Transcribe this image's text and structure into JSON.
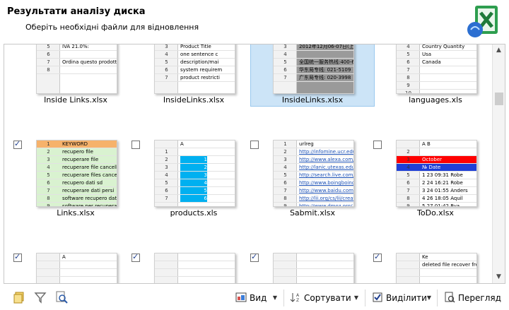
{
  "header": {
    "title": "Результати аналізу диска",
    "subtitle": "Оберіть необхідні файли для відновлення"
  },
  "files": [
    {
      "name": "Inside Links.xlsx",
      "selected": false,
      "checked": false,
      "rows": [
        {
          "n": "3",
          "t": ""
        },
        {
          "n": "4",
          "t": ""
        },
        {
          "n": "5",
          "t": "IVA 21.0%:"
        },
        {
          "n": "6",
          "t": ""
        },
        {
          "n": "7",
          "t": "Ordina questo prodotto"
        },
        {
          "n": "8",
          "t": ""
        }
      ]
    },
    {
      "name": "InsideLinks.xlsx",
      "selected": false,
      "checked": false,
      "rows": [
        {
          "n": "1",
          "t": ""
        },
        {
          "n": "2",
          "t": ""
        },
        {
          "n": "3",
          "t": "Product Title"
        },
        {
          "n": "4",
          "t": "one sentence c"
        },
        {
          "n": "5",
          "t": "description/mai"
        },
        {
          "n": "6",
          "t": "system requirem"
        },
        {
          "n": "7",
          "t": "product restricti"
        }
      ]
    },
    {
      "name": "InsideLinks.xlsx",
      "selected": true,
      "checked": false,
      "rows": [
        {
          "n": "1",
          "t": ""
        },
        {
          "n": "2",
          "t": "2012年11月03-04日(深圳"
        },
        {
          "n": "3",
          "t": "2012年12月06-07日(上海"
        },
        {
          "n": "4",
          "t": ""
        },
        {
          "n": "5",
          "t": "全国统一服务热线:400-6"
        },
        {
          "n": "6",
          "t": "华东局专线: 021-5109"
        },
        {
          "n": "7",
          "t": "广东局专线: 020-3998"
        }
      ]
    },
    {
      "name": "languages.xls",
      "selected": false,
      "checked": false,
      "rows": [
        {
          "n": "2",
          "t": "(A2)"
        },
        {
          "n": "3",
          "t": ""
        },
        {
          "n": "4",
          "t": "Country    Quantity"
        },
        {
          "n": "5",
          "t": "Usa"
        },
        {
          "n": "6",
          "t": "Canada"
        },
        {
          "n": "7",
          "t": ""
        },
        {
          "n": "8",
          "t": ""
        },
        {
          "n": "9",
          "t": ""
        },
        {
          "n": "10",
          "t": ""
        }
      ]
    },
    {
      "name": "Links.xlsx",
      "selected": false,
      "checked": true,
      "rows": [
        {
          "n": "1",
          "t": "KEYWORD"
        },
        {
          "n": "2",
          "t": "recupero file"
        },
        {
          "n": "3",
          "t": "recuperare file"
        },
        {
          "n": "4",
          "t": "recuperare file cancellati"
        },
        {
          "n": "5",
          "t": "recuperare files cancellati d"
        },
        {
          "n": "6",
          "t": "recupero dati sd"
        },
        {
          "n": "7",
          "t": "recuperare dati persi"
        },
        {
          "n": "8",
          "t": "software recupero dati free"
        },
        {
          "n": "9",
          "t": "software per recuperare file"
        }
      ]
    },
    {
      "name": "products.xls",
      "selected": false,
      "checked": false,
      "rows": [
        {
          "n": "",
          "t": "A"
        },
        {
          "n": "1",
          "t": ""
        },
        {
          "n": "2",
          "t": "1"
        },
        {
          "n": "3",
          "t": "2"
        },
        {
          "n": "4",
          "t": "3"
        },
        {
          "n": "5",
          "t": "4"
        },
        {
          "n": "6",
          "t": "5"
        },
        {
          "n": "7",
          "t": "6"
        }
      ]
    },
    {
      "name": "Sabmit.xlsx",
      "selected": false,
      "checked": false,
      "rows": [
        {
          "n": "1",
          "t": "urlreg"
        },
        {
          "n": "2",
          "t": "http://infomine.ucr.edu/"
        },
        {
          "n": "3",
          "t": "http://www.alexa.com/si"
        },
        {
          "n": "4",
          "t": "http://lanic.utexas.edu/l"
        },
        {
          "n": "5",
          "t": "http://search.live.com/d"
        },
        {
          "n": "6",
          "t": "http://www.boingboing.n"
        },
        {
          "n": "7",
          "t": "http://www.baidu.com/s"
        },
        {
          "n": "8",
          "t": "http://lii.org/cs/lii/create"
        },
        {
          "n": "9",
          "t": "http://www.dmoz.org/"
        },
        {
          "n": "10",
          "t": "http://www.exalead.com"
        }
      ]
    },
    {
      "name": "ToDo.xlsx",
      "selected": false,
      "checked": false,
      "rows": [
        {
          "n": "",
          "t": "A     B"
        },
        {
          "n": "2",
          "t": ""
        },
        {
          "n": "3",
          "t": "October"
        },
        {
          "n": "4",
          "t": "№   Date"
        },
        {
          "n": "5",
          "t": "1   23 09:31   Robe"
        },
        {
          "n": "6",
          "t": "2   24 16:21   Robe"
        },
        {
          "n": "7",
          "t": "3   24 01:55   Anders"
        },
        {
          "n": "8",
          "t": "4   26 18:05   Aquil"
        },
        {
          "n": "9",
          "t": "5   27 01:42   Rya"
        },
        {
          "n": "10",
          "t": "6   27 04:56   Sams"
        }
      ]
    },
    {
      "name": "",
      "selected": false,
      "checked": true,
      "rows": [
        {
          "n": "",
          "t": "A"
        },
        {
          "n": "",
          "t": ""
        },
        {
          "n": "",
          "t": ""
        }
      ]
    },
    {
      "name": "",
      "selected": false,
      "checked": true,
      "rows": [
        {
          "n": "",
          "t": ""
        },
        {
          "n": "",
          "t": ""
        },
        {
          "n": "",
          "t": ""
        }
      ]
    },
    {
      "name": "",
      "selected": false,
      "checked": true,
      "rows": [
        {
          "n": "",
          "t": ""
        },
        {
          "n": "",
          "t": ""
        },
        {
          "n": "",
          "t": ""
        }
      ]
    },
    {
      "name": "",
      "selected": false,
      "checked": true,
      "rows": [
        {
          "n": "",
          "t": "Ke"
        },
        {
          "n": "",
          "t": "deleted file recover freel"
        },
        {
          "n": "",
          "t": ""
        }
      ]
    }
  ],
  "toolbar": {
    "view_label": "Вид",
    "sort_label": "Сортувати",
    "select_label": "Виділити",
    "preview_label": "Перегляд"
  }
}
